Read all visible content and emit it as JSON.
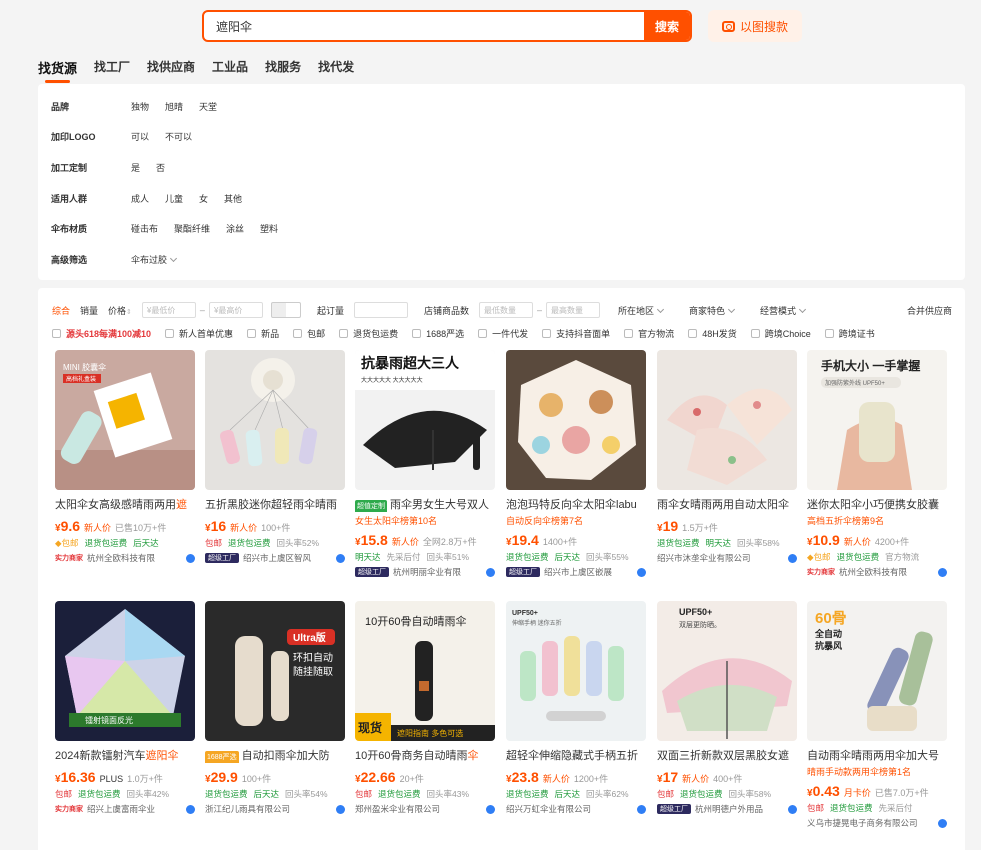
{
  "search": {
    "value": "遮阳伞",
    "button": "搜索",
    "image_search": "以图搜款"
  },
  "tabs": [
    "找货源",
    "找工厂",
    "找供应商",
    "工业品",
    "找服务",
    "找代发"
  ],
  "filters": [
    {
      "label": "品牌",
      "options": [
        "独物",
        "旭晴",
        "天堂"
      ]
    },
    {
      "label": "加印LOGO",
      "options": [
        "可以",
        "不可以"
      ]
    },
    {
      "label": "加工定制",
      "options": [
        "是",
        "否"
      ]
    },
    {
      "label": "适用人群",
      "options": [
        "成人",
        "儿童",
        "女",
        "其他"
      ]
    },
    {
      "label": "伞布材质",
      "options": [
        "碰击布",
        "聚酯纤维",
        "涂丝",
        "塑料"
      ]
    },
    {
      "label": "高级筛选",
      "options": [
        "伞布过胶"
      ]
    }
  ],
  "sortbar": {
    "comprehensive": "综合",
    "sales": "销量",
    "price": "价格",
    "price_min": "¥最低价",
    "price_max": "¥最高价",
    "moq": "起订量",
    "shop_count": "店铺商品数",
    "shop_min": "最低数量",
    "shop_max": "最高数量",
    "location": "所在地区",
    "merchant": "商家特色",
    "mode": "经营模式",
    "merge": "合并供应商"
  },
  "tags": [
    "源头618每满100减10",
    "新人首单优惠",
    "新品",
    "包邮",
    "退货包运费",
    "1688严选",
    "一件代发",
    "支持抖音面单",
    "官方物流",
    "48H发货",
    "跨境Choice",
    "跨境证书"
  ],
  "products": [
    {
      "title": "太阳伞女高级感晴雨两用",
      "hl": "遮",
      "sub": "",
      "price": "9.6",
      "plabel": "新人价",
      "sold": "已售10万+件",
      "badges": [
        [
          "dia",
          "包邮"
        ],
        [
          "green",
          "退货包运费"
        ],
        [
          "green",
          "后天达"
        ]
      ],
      "shop": "杭州全欧科技有限",
      "sbadge": "实力商家"
    },
    {
      "title": "五折黑胶迷你超轻雨伞晴雨",
      "hl": "",
      "sub": "",
      "price": "16",
      "plabel": "新人价",
      "sold": "100+件",
      "badges": [
        [
          "red",
          "包邮"
        ],
        [
          "green",
          "退货包运费"
        ],
        [
          "gray",
          "回头率52%"
        ]
      ],
      "shop": "绍兴市上虞区智风",
      "sbadge": "超级工厂"
    },
    {
      "title": "雨伞男女生大号双人",
      "hl": "",
      "chip": "超值定制",
      "sub": "女生太阳伞榜第10名",
      "price": "15.8",
      "plabel": "新人价",
      "sold": "全网2.8万+件",
      "badges": [
        [
          "green",
          "明天达"
        ],
        [
          "gray",
          "先采后付"
        ],
        [
          "gray",
          "回头率51%"
        ]
      ],
      "shop": "杭州明丽伞业有限",
      "sbadge": "超级工厂"
    },
    {
      "title": "泡泡玛特反向伞太阳伞labu",
      "hl": "",
      "sub": "自动反向伞榜第7名",
      "price": "19.4",
      "plabel": "",
      "sold": "1400+件",
      "badges": [
        [
          "green",
          "退货包运费"
        ],
        [
          "green",
          "后天达"
        ],
        [
          "gray",
          "回头率55%"
        ]
      ],
      "shop": "绍兴市上虞区嵌展",
      "sbadge": "超级工厂"
    },
    {
      "title": "雨伞女晴雨两用自动太阳伞",
      "hl": "",
      "sub": "",
      "price": "19",
      "plabel": "",
      "sold": "1.5万+件",
      "badges": [
        [
          "green",
          "退货包运费"
        ],
        [
          "green",
          "明天达"
        ],
        [
          "gray",
          "回头率58%"
        ]
      ],
      "shop": "绍兴市沐垄伞业有限公司",
      "sbadge": ""
    },
    {
      "title": "迷你太阳伞小巧便携女胶囊",
      "hl": "",
      "sub": "高档五折伞榜第9名",
      "price": "10.9",
      "plabel": "新人价",
      "sold": "4200+件",
      "badges": [
        [
          "dia",
          "包邮"
        ],
        [
          "green",
          "退货包运费"
        ],
        [
          "gray",
          "官方物流"
        ]
      ],
      "shop": "杭州全欧科技有限",
      "sbadge": "实力商家"
    },
    {
      "title": "2024新款镭射汽车",
      "hl": "遮阳伞",
      "sub": "",
      "price": "16.36",
      "plabel": "",
      "plus": "PLUS",
      "sold": "1.0万+件",
      "badges": [
        [
          "red",
          "包邮"
        ],
        [
          "green",
          "退货包运费"
        ],
        [
          "gray",
          "回头率42%"
        ]
      ],
      "shop": "绍兴上虞富雨伞业",
      "sbadge": "实力商家"
    },
    {
      "title": "自动扣雨伞加大防",
      "hl": "",
      "chip": "1688严选",
      "sub": "",
      "price": "29.9",
      "plabel": "",
      "sold": "100+件",
      "badges": [
        [
          "green",
          "退货包运费"
        ],
        [
          "green",
          "后天达"
        ],
        [
          "gray",
          "回头率54%"
        ]
      ],
      "shop": "浙江纪儿雨具有限公司",
      "sbadge": ""
    },
    {
      "title": "10开60骨商务自动晴雨",
      "hl": "伞",
      "sub": "",
      "price": "22.66",
      "plabel": "",
      "sold": "20+件",
      "badges": [
        [
          "red",
          "包邮"
        ],
        [
          "green",
          "退货包运费"
        ],
        [
          "gray",
          "回头率43%"
        ]
      ],
      "shop": "郑州盈米伞业有限公司",
      "sbadge": ""
    },
    {
      "title": "超轻伞伸缩隐藏式手柄五折",
      "hl": "",
      "sub": "",
      "price": "23.8",
      "plabel": "新人价",
      "sold": "1200+件",
      "badges": [
        [
          "green",
          "退货包运费"
        ],
        [
          "green",
          "后天达"
        ],
        [
          "gray",
          "回头率62%"
        ]
      ],
      "shop": "绍兴万虹伞业有限公司",
      "sbadge": ""
    },
    {
      "title": "双面三折新款双层黑胶女遮",
      "hl": "",
      "sub": "",
      "price": "17",
      "plabel": "新人价",
      "sold": "400+件",
      "badges": [
        [
          "red",
          "包邮"
        ],
        [
          "green",
          "退货包运费"
        ],
        [
          "gray",
          "回头率58%"
        ]
      ],
      "shop": "杭州明德户外用品",
      "sbadge": "超级工厂"
    },
    {
      "title": "自动雨伞晴雨两用伞加大号",
      "hl": "",
      "sub": "晴雨手动款两用伞榜第1名",
      "price": "0.43",
      "plabel": "月卡价",
      "sold": "已售7.0万+件",
      "badges": [
        [
          "red",
          "包邮"
        ],
        [
          "green",
          "退货包运费"
        ],
        [
          "gray",
          "先采后付"
        ]
      ],
      "shop": "义乌市捷晃电子商务有限公司",
      "sbadge": ""
    }
  ],
  "image_text": {
    "p1": [
      "MINI 胶囊伞",
      "高档礼盒装"
    ],
    "p3": [
      "抗暴雨超大三人",
      "大大大大大  大大大大大"
    ],
    "p6": [
      "手机大小 一手掌握",
      "加强防紫外线 UPF50+"
    ],
    "p8": [
      "Ultra版",
      "环扣自动",
      "随挂随取"
    ],
    "p9": [
      "10开60骨自动晴雨伞",
      "现货",
      "遮阳指南 多色可选"
    ],
    "p10": [
      "UPF50+",
      "伸缩手柄 迷你五折"
    ],
    "p11": [
      "UPF50+",
      "双层更防晒。"
    ],
    "p12": [
      "60骨",
      "全自动",
      "抗暴风"
    ]
  }
}
